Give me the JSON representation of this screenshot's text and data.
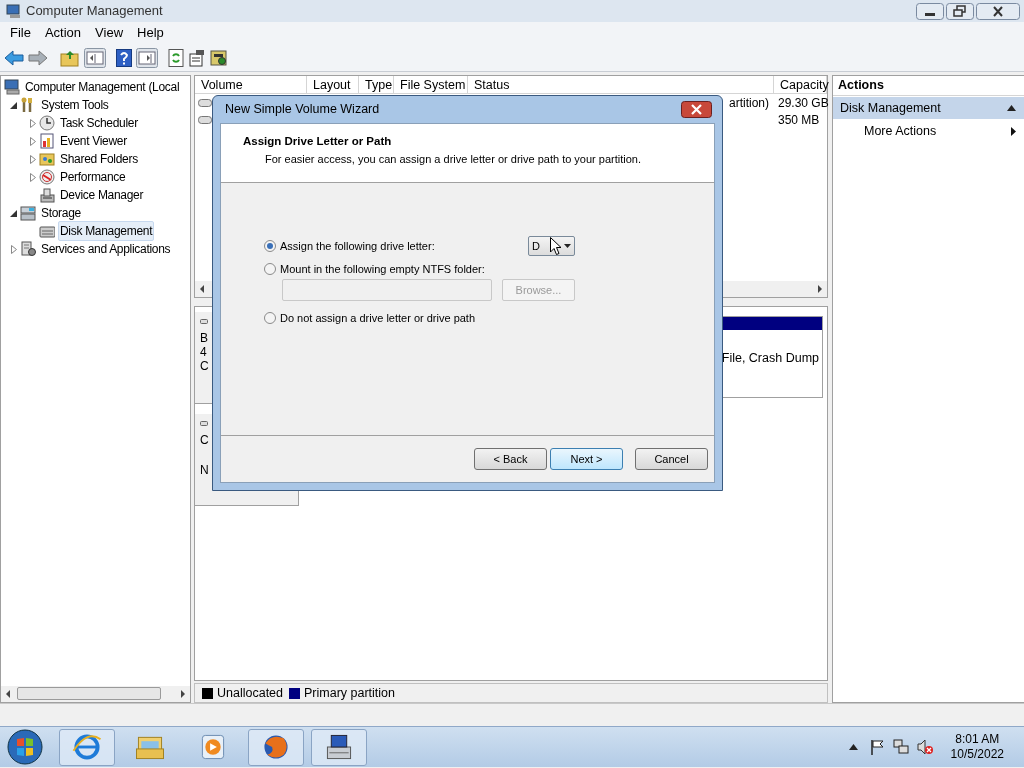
{
  "window": {
    "title": "Computer Management"
  },
  "menu": [
    "File",
    "Action",
    "View",
    "Help"
  ],
  "tree": [
    {
      "label": "Computer Management (Local",
      "selected": false,
      "children": [
        {
          "label": "System Tools",
          "expanded": true,
          "selected": false,
          "children": [
            {
              "label": "Task Scheduler",
              "expanded": false,
              "selected": false
            },
            {
              "label": "Event Viewer",
              "expanded": false,
              "selected": false
            },
            {
              "label": "Shared Folders",
              "expanded": false,
              "selected": false
            },
            {
              "label": "Performance",
              "expanded": false,
              "selected": false
            },
            {
              "label": "Device Manager",
              "selected": false
            }
          ]
        },
        {
          "label": "Storage",
          "expanded": true,
          "selected": false,
          "children": [
            {
              "label": "Disk Management",
              "selected": true
            }
          ]
        },
        {
          "label": "Services and Applications",
          "expanded": false,
          "selected": false
        }
      ]
    }
  ],
  "volume_list": {
    "columns": [
      "Volume",
      "Layout",
      "Type",
      "File System",
      "Status",
      "Capacity"
    ],
    "rows": [
      {
        "status": "artition)",
        "capacity": "29.30 GB"
      },
      {
        "capacity": "350 MB"
      }
    ]
  },
  "disks": [
    {
      "label_lines": [
        "B",
        "4",
        "C"
      ],
      "partition_text": "File, Crash Dump"
    },
    {
      "label_lines": [
        "C",
        "N"
      ]
    }
  ],
  "legend": [
    {
      "label": "Unallocated",
      "color": "#000000"
    },
    {
      "label": "Primary partition",
      "color": "#000080"
    }
  ],
  "actions": {
    "title": "Actions",
    "section": {
      "label": "Disk Management",
      "expanded": true
    },
    "items": [
      "More Actions"
    ]
  },
  "dialog": {
    "title": "New Simple Volume Wizard",
    "heading": "Assign Drive Letter or Path",
    "subheading": "For easier access, you can assign a drive letter or drive path to your partition.",
    "options": [
      {
        "label": "Assign the following drive letter:",
        "selected": true
      },
      {
        "label": "Mount in the following empty NTFS folder:",
        "selected": false
      },
      {
        "label": "Do not assign a drive letter or drive path",
        "selected": false
      }
    ],
    "drive_letter": "D",
    "folder_field": {
      "disabled": true
    },
    "browse": {
      "label": "Browse...",
      "disabled": true
    },
    "buttons": [
      {
        "label": "< Back",
        "default": false
      },
      {
        "label": "Next >",
        "default": true
      },
      {
        "label": "Cancel",
        "default": false
      }
    ]
  },
  "clock": {
    "time": "8:01 AM",
    "date": "10/5/2022"
  }
}
